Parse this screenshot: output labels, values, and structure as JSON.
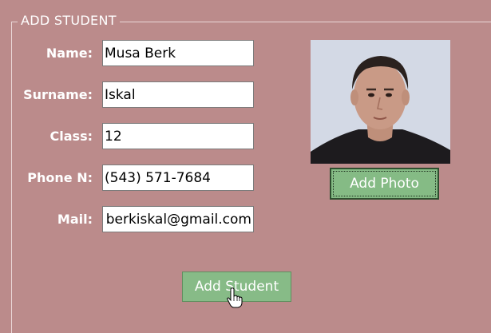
{
  "groupbox": {
    "title": "ADD STUDENT"
  },
  "form": {
    "name_label": "Name:",
    "name_value": "Musa Berk",
    "surname_label": "Surname:",
    "surname_value": "Iskal",
    "class_label": "Class:",
    "class_value": "12",
    "phone_label": "Phone N:",
    "phone_value": "(543) 571-7684",
    "mail_label": "Mail:",
    "mail_value": "musa.berkiskal@gmail.com"
  },
  "photo": {
    "button_label": "Add Photo"
  },
  "actions": {
    "add_student_label": "Add Student"
  },
  "icons": {
    "cursor": "hand-pointer-icon"
  },
  "colors": {
    "background": "#bb8b8b",
    "button_green": "#87bb87",
    "label_text": "#ffffff"
  }
}
